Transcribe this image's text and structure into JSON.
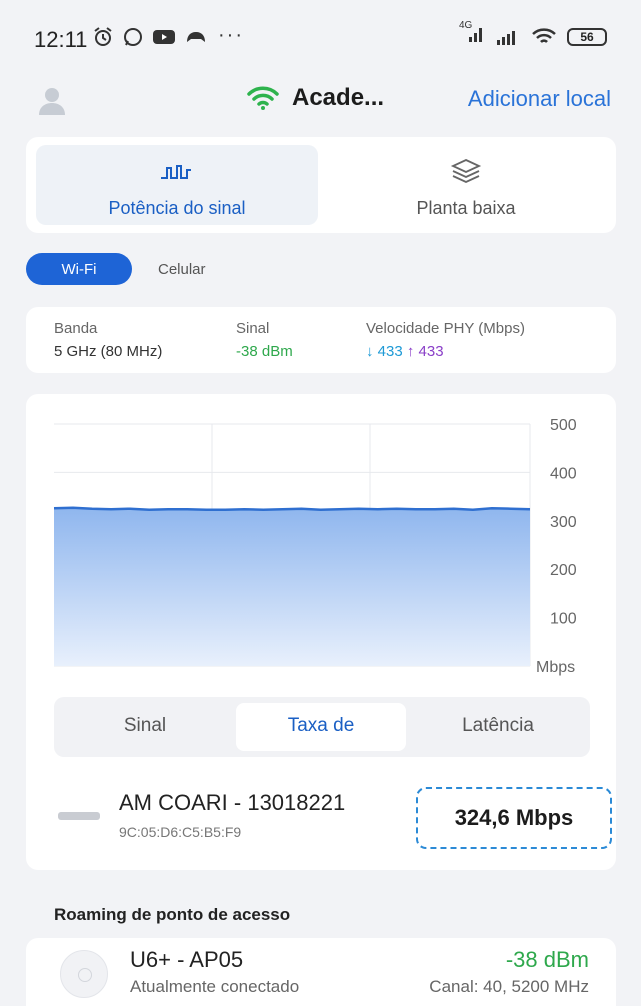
{
  "status_bar": {
    "time": "12:11",
    "dots": "···",
    "network_label": "4G",
    "battery": "56"
  },
  "header": {
    "network_name": "Acade...",
    "add_location": "Adicionar local"
  },
  "view_tabs": {
    "signal_strength": "Potência do sinal",
    "floor_plan": "Planta baixa"
  },
  "connection_toggle": {
    "wifi": "Wi-Fi",
    "cellular": "Celular"
  },
  "info": {
    "band_label": "Banda",
    "band_value": "5 GHz (80 MHz)",
    "signal_label": "Sinal",
    "signal_value": "-38 dBm",
    "phy_label": "Velocidade PHY (Mbps)",
    "phy_down": "↓ 433",
    "phy_up": "↑ 433"
  },
  "chart_data": {
    "type": "area",
    "ylim": [
      0,
      500
    ],
    "y_ticks": [
      "500",
      "400",
      "300",
      "200",
      "100"
    ],
    "y_unit": "Mbps",
    "values": [
      326,
      327,
      325,
      324,
      325,
      323,
      324,
      324,
      323,
      323,
      324,
      323,
      324,
      325,
      323,
      324,
      325,
      324,
      325,
      324,
      324,
      325,
      323,
      326,
      325,
      324
    ],
    "color": "#2f6fd0"
  },
  "metric_tabs": {
    "signal": "Sinal",
    "rate": "Taxa de",
    "latency": "Latência"
  },
  "device": {
    "name": "AM COARI - 13018221",
    "mac": "9C:05:D6:C5:B5:F9",
    "speed": "324,6 Mbps"
  },
  "roaming": {
    "title": "Roaming de ponto de acesso",
    "ap_name": "U6+ - AP05",
    "ap_status": "Atualmente conectado",
    "ap_signal": "-38 dBm",
    "ap_channel": "Canal: 40, 5200 MHz"
  }
}
